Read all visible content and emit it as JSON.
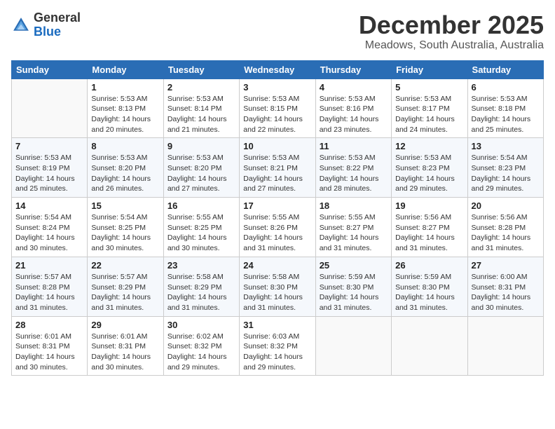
{
  "logo": {
    "general": "General",
    "blue": "Blue"
  },
  "title": "December 2025",
  "subtitle": "Meadows, South Australia, Australia",
  "weekdays": [
    "Sunday",
    "Monday",
    "Tuesday",
    "Wednesday",
    "Thursday",
    "Friday",
    "Saturday"
  ],
  "weeks": [
    [
      {
        "day": "",
        "info": ""
      },
      {
        "day": "1",
        "info": "Sunrise: 5:53 AM\nSunset: 8:13 PM\nDaylight: 14 hours\nand 20 minutes."
      },
      {
        "day": "2",
        "info": "Sunrise: 5:53 AM\nSunset: 8:14 PM\nDaylight: 14 hours\nand 21 minutes."
      },
      {
        "day": "3",
        "info": "Sunrise: 5:53 AM\nSunset: 8:15 PM\nDaylight: 14 hours\nand 22 minutes."
      },
      {
        "day": "4",
        "info": "Sunrise: 5:53 AM\nSunset: 8:16 PM\nDaylight: 14 hours\nand 23 minutes."
      },
      {
        "day": "5",
        "info": "Sunrise: 5:53 AM\nSunset: 8:17 PM\nDaylight: 14 hours\nand 24 minutes."
      },
      {
        "day": "6",
        "info": "Sunrise: 5:53 AM\nSunset: 8:18 PM\nDaylight: 14 hours\nand 25 minutes."
      }
    ],
    [
      {
        "day": "7",
        "info": "Sunrise: 5:53 AM\nSunset: 8:19 PM\nDaylight: 14 hours\nand 25 minutes."
      },
      {
        "day": "8",
        "info": "Sunrise: 5:53 AM\nSunset: 8:20 PM\nDaylight: 14 hours\nand 26 minutes."
      },
      {
        "day": "9",
        "info": "Sunrise: 5:53 AM\nSunset: 8:20 PM\nDaylight: 14 hours\nand 27 minutes."
      },
      {
        "day": "10",
        "info": "Sunrise: 5:53 AM\nSunset: 8:21 PM\nDaylight: 14 hours\nand 27 minutes."
      },
      {
        "day": "11",
        "info": "Sunrise: 5:53 AM\nSunset: 8:22 PM\nDaylight: 14 hours\nand 28 minutes."
      },
      {
        "day": "12",
        "info": "Sunrise: 5:53 AM\nSunset: 8:23 PM\nDaylight: 14 hours\nand 29 minutes."
      },
      {
        "day": "13",
        "info": "Sunrise: 5:54 AM\nSunset: 8:23 PM\nDaylight: 14 hours\nand 29 minutes."
      }
    ],
    [
      {
        "day": "14",
        "info": "Sunrise: 5:54 AM\nSunset: 8:24 PM\nDaylight: 14 hours\nand 30 minutes."
      },
      {
        "day": "15",
        "info": "Sunrise: 5:54 AM\nSunset: 8:25 PM\nDaylight: 14 hours\nand 30 minutes."
      },
      {
        "day": "16",
        "info": "Sunrise: 5:55 AM\nSunset: 8:25 PM\nDaylight: 14 hours\nand 30 minutes."
      },
      {
        "day": "17",
        "info": "Sunrise: 5:55 AM\nSunset: 8:26 PM\nDaylight: 14 hours\nand 31 minutes."
      },
      {
        "day": "18",
        "info": "Sunrise: 5:55 AM\nSunset: 8:27 PM\nDaylight: 14 hours\nand 31 minutes."
      },
      {
        "day": "19",
        "info": "Sunrise: 5:56 AM\nSunset: 8:27 PM\nDaylight: 14 hours\nand 31 minutes."
      },
      {
        "day": "20",
        "info": "Sunrise: 5:56 AM\nSunset: 8:28 PM\nDaylight: 14 hours\nand 31 minutes."
      }
    ],
    [
      {
        "day": "21",
        "info": "Sunrise: 5:57 AM\nSunset: 8:28 PM\nDaylight: 14 hours\nand 31 minutes."
      },
      {
        "day": "22",
        "info": "Sunrise: 5:57 AM\nSunset: 8:29 PM\nDaylight: 14 hours\nand 31 minutes."
      },
      {
        "day": "23",
        "info": "Sunrise: 5:58 AM\nSunset: 8:29 PM\nDaylight: 14 hours\nand 31 minutes."
      },
      {
        "day": "24",
        "info": "Sunrise: 5:58 AM\nSunset: 8:30 PM\nDaylight: 14 hours\nand 31 minutes."
      },
      {
        "day": "25",
        "info": "Sunrise: 5:59 AM\nSunset: 8:30 PM\nDaylight: 14 hours\nand 31 minutes."
      },
      {
        "day": "26",
        "info": "Sunrise: 5:59 AM\nSunset: 8:30 PM\nDaylight: 14 hours\nand 31 minutes."
      },
      {
        "day": "27",
        "info": "Sunrise: 6:00 AM\nSunset: 8:31 PM\nDaylight: 14 hours\nand 30 minutes."
      }
    ],
    [
      {
        "day": "28",
        "info": "Sunrise: 6:01 AM\nSunset: 8:31 PM\nDaylight: 14 hours\nand 30 minutes."
      },
      {
        "day": "29",
        "info": "Sunrise: 6:01 AM\nSunset: 8:31 PM\nDaylight: 14 hours\nand 30 minutes."
      },
      {
        "day": "30",
        "info": "Sunrise: 6:02 AM\nSunset: 8:32 PM\nDaylight: 14 hours\nand 29 minutes."
      },
      {
        "day": "31",
        "info": "Sunrise: 6:03 AM\nSunset: 8:32 PM\nDaylight: 14 hours\nand 29 minutes."
      },
      {
        "day": "",
        "info": ""
      },
      {
        "day": "",
        "info": ""
      },
      {
        "day": "",
        "info": ""
      }
    ]
  ]
}
